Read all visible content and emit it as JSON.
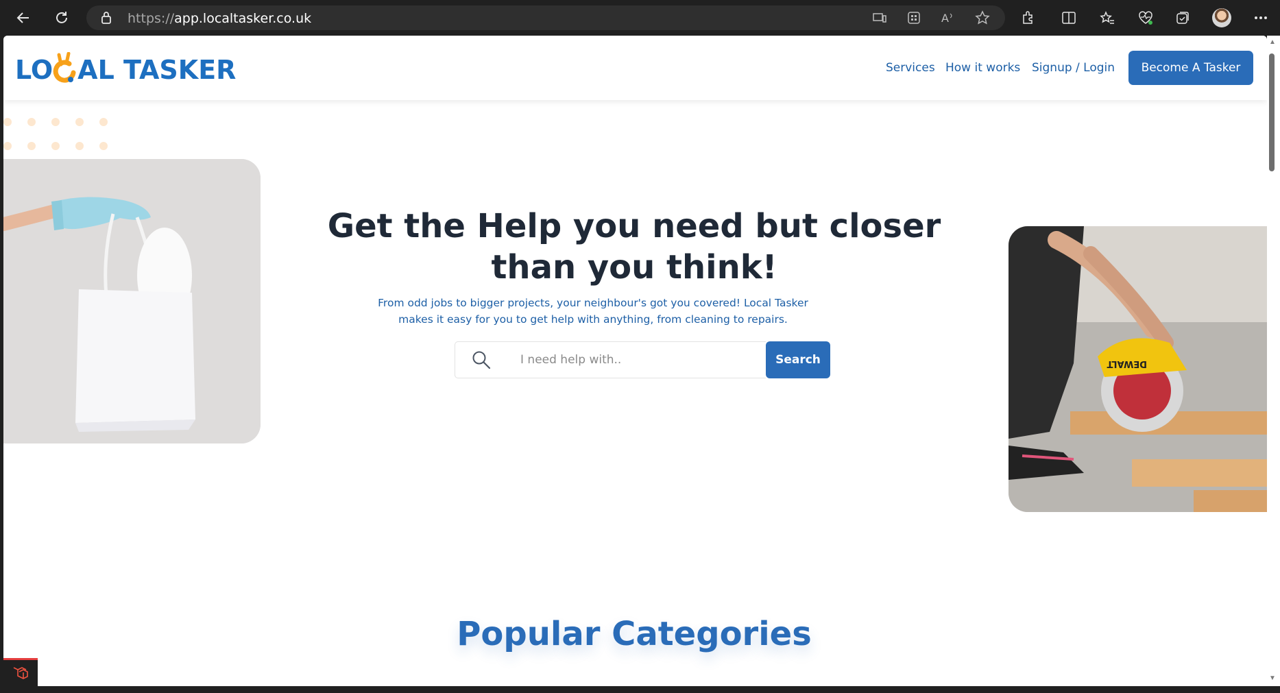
{
  "browser": {
    "url_protocol": "https://",
    "url_host": "app.localtasker.co.uk"
  },
  "header": {
    "logo_part1": "LO",
    "logo_part2": "AL TASKER",
    "nav": [
      {
        "label": "Services"
      },
      {
        "label": "How it works"
      },
      {
        "label": "Signup / Login"
      }
    ],
    "cta_label": "Become A Tasker"
  },
  "hero": {
    "title": "Get the Help you need but closer than you think!",
    "subtitle": "From odd jobs to bigger projects, your neighbour's got you covered! Local Tasker makes it easy for you to get help with anything, from cleaning to repairs.",
    "search_placeholder": "I need help with..",
    "search_button": "Search"
  },
  "sections": {
    "popular_categories_title": "Popular Categories"
  },
  "colors": {
    "brand_blue": "#2a6cb8",
    "logo_orange": "#f7a11a",
    "heading_dark": "#1f2937"
  }
}
